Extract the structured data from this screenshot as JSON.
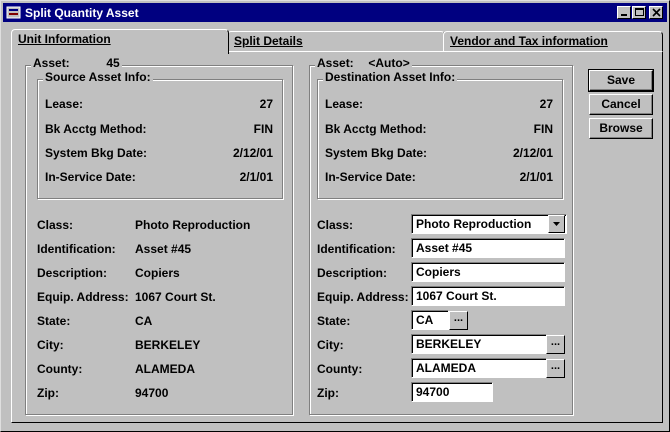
{
  "window": {
    "title": "Split Quantity Asset"
  },
  "tabs": [
    {
      "label": "Unit Information",
      "hotkey_index": 0
    },
    {
      "label": "Split Details",
      "hotkey_index": 0
    },
    {
      "label": "Vendor and Tax information",
      "hotkey_index": 0
    }
  ],
  "source": {
    "asset_label": "Asset:",
    "asset_value": "45",
    "info_title": "Source Asset Info:",
    "lease_label": "Lease:",
    "lease_value": "27",
    "method_label": "Bk Acctg Method:",
    "method_value": "FIN",
    "sysdate_label": "System Bkg Date:",
    "sysdate_value": "2/12/01",
    "inservice_label": "In-Service Date:",
    "inservice_value": "2/1/01",
    "class_label": "Class:",
    "class_value": "Photo Reproduction",
    "ident_label": "Identification:",
    "ident_value": "Asset #45",
    "desc_label": "Description:",
    "desc_value": "Copiers",
    "addr_label": "Equip. Address:",
    "addr_value": "1067 Court St.",
    "state_label": "State:",
    "state_value": "CA",
    "city_label": "City:",
    "city_value": "BERKELEY",
    "county_label": "County:",
    "county_value": "ALAMEDA",
    "zip_label": "Zip:",
    "zip_value": "94700"
  },
  "destination": {
    "asset_label": "Asset:",
    "asset_value": "<Auto>",
    "info_title": "Destination Asset Info:",
    "lease_label": "Lease:",
    "lease_value": "27",
    "method_label": "Bk Acctg Method:",
    "method_value": "FIN",
    "sysdate_label": "System Bkg Date:",
    "sysdate_value": "2/12/01",
    "inservice_label": "In-Service Date:",
    "inservice_value": "2/1/01",
    "class_label": "Class:",
    "class_value": "Photo Reproduction",
    "ident_label": "Identification:",
    "ident_value": "Asset #45",
    "desc_label": "Description:",
    "desc_value": "Copiers",
    "addr_label": "Equip. Address:",
    "addr_value": "1067 Court St.",
    "state_label": "State:",
    "state_value": "CA",
    "city_label": "City:",
    "city_value": "BERKELEY",
    "county_label": "County:",
    "county_value": "ALAMEDA",
    "zip_label": "Zip:",
    "zip_value": "94700",
    "browse_glyph": "..."
  },
  "buttons": {
    "save": "Save",
    "cancel": "Cancel",
    "browse": "Browse"
  },
  "icons": {
    "title": "window-app-icon",
    "minimize": "minimize-icon",
    "maximize": "maximize-icon",
    "close": "close-icon",
    "dropdown": "chevron-down-icon"
  }
}
